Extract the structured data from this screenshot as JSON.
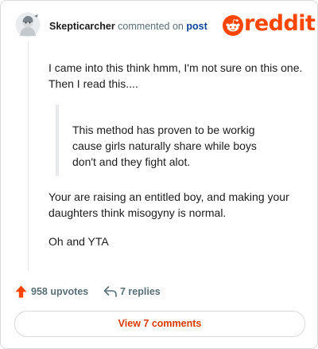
{
  "header": {
    "author": "Skepticarcher",
    "verb": "commented on",
    "post_link": "post",
    "brand": "reddit"
  },
  "comment": {
    "paragraph1": "I came into this think hmm, I'm not sure on this one. Then I read this....",
    "quote": "This method has proven to be workig cause girls naturally share while boys don't and they fight alot.",
    "paragraph2": "Your are raising an entitled boy, and making your daughters think misogyny is normal.",
    "paragraph3": "Oh and YTA"
  },
  "actions": {
    "upvotes_label": "958 upvotes",
    "replies_label": "7 replies"
  },
  "footer": {
    "view_comments_label": "View 7 comments"
  },
  "colors": {
    "brand": "#ff4500",
    "upvote": "#ff4500",
    "link": "#0a449b",
    "button_text": "#d93a00"
  },
  "icons": {
    "avatar": "user-avatar",
    "brand": "reddit-snoo-icon",
    "upvote": "upvote-arrow-icon",
    "reply": "reply-arrow-icon"
  }
}
